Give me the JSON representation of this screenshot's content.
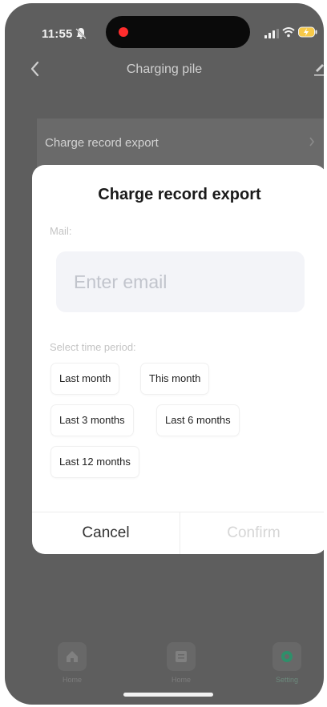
{
  "status_bar": {
    "time": "11:55"
  },
  "nav": {
    "title": "Charging pile"
  },
  "background": {
    "row_label": "Charge record export"
  },
  "tab_bar": {
    "items": [
      {
        "label": "Home",
        "icon": "home-icon"
      },
      {
        "label": "Home",
        "icon": "card-icon"
      },
      {
        "label": "Setting",
        "icon": "settings-icon",
        "active": true
      }
    ]
  },
  "modal": {
    "title": "Charge record export",
    "mail_label": "Mail:",
    "email_placeholder": "Enter email",
    "email_value": "",
    "period_label": "Select time period:",
    "periods": [
      "Last month",
      "This month",
      "Last 3 months",
      "Last 6 months",
      "Last 12 months"
    ],
    "cancel_label": "Cancel",
    "confirm_label": "Confirm"
  },
  "colors": {
    "overlay": "#5e5e5e",
    "input_bg": "#f3f4f8",
    "confirm_disabled": "#d6d6d6",
    "active_tab": "#2f8f6a"
  }
}
